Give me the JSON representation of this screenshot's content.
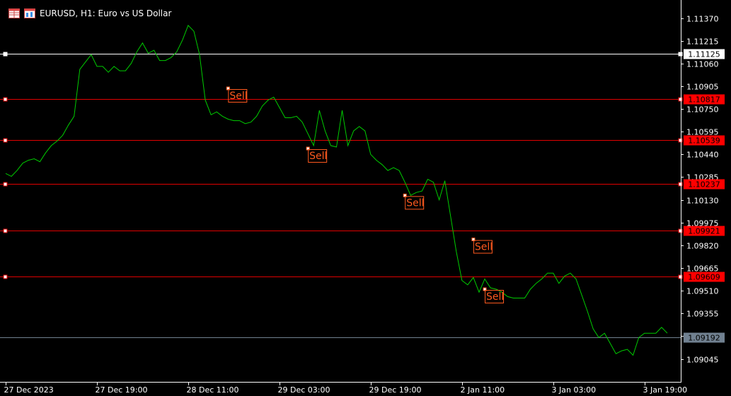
{
  "header": {
    "title": "EURUSD, H1:  Euro vs US Dollar",
    "icons": [
      "table-icon",
      "chart-icon"
    ]
  },
  "colors": {
    "background": "#000000",
    "price_line": "#00cc00",
    "sell_level": "#e00000",
    "current_level": "#ffffff",
    "bid_level": "#708090",
    "sell_label": "#ff5a1f",
    "text": "#ffffff"
  },
  "chart_data": {
    "type": "line",
    "symbol": "EURUSD",
    "timeframe": "H1",
    "title": "EURUSD, H1:  Euro vs US Dollar",
    "ylim": [
      1.0898,
      1.1145
    ],
    "y_ticks": [
      "1.11370",
      "1.11215",
      "1.11060",
      "1.10905",
      "1.10750",
      "1.10595",
      "1.10440",
      "1.10285",
      "1.10130",
      "1.09975",
      "1.09820",
      "1.09665",
      "1.09510",
      "1.09355",
      "1.09200",
      "1.09045"
    ],
    "x_ticks": [
      "27 Dec 2023",
      "27 Dec 19:00",
      "28 Dec 11:00",
      "29 Dec 03:00",
      "29 Dec 19:00",
      "2 Jan 11:00",
      "3 Jan 03:00",
      "3 Jan 19:00"
    ],
    "x_tick_bars": [
      0,
      16,
      32,
      48,
      64,
      80,
      96,
      112
    ],
    "series": [
      {
        "values": [
          1.1031,
          1.1029,
          1.1033,
          1.1038,
          1.104,
          1.1041,
          1.1039,
          1.1045,
          1.105,
          1.1053,
          1.1057,
          1.1064,
          1.107,
          1.1102,
          1.1107,
          1.1112,
          1.1104,
          1.1104,
          1.11,
          1.1104,
          1.1101,
          1.1101,
          1.1106,
          1.1114,
          1.112,
          1.1113,
          1.1115,
          1.1108,
          1.1108,
          1.111,
          1.1114,
          1.1122,
          1.1132,
          1.1128,
          1.1112,
          1.1081,
          1.1071,
          1.1073,
          1.107,
          1.1068,
          1.1067,
          1.1067,
          1.1065,
          1.1066,
          1.107,
          1.1077,
          1.1081,
          1.1083,
          1.1076,
          1.1069,
          1.1069,
          1.107,
          1.1066,
          1.1058,
          1.105,
          1.1074,
          1.106,
          1.105,
          1.1049,
          1.1074,
          1.105,
          1.106,
          1.1063,
          1.106,
          1.1044,
          1.104,
          1.1037,
          1.1033,
          1.1035,
          1.1033,
          1.1025,
          1.1016,
          1.1018,
          1.1019,
          1.1027,
          1.1025,
          1.1013,
          1.1026,
          1.1002,
          1.0978,
          1.0958,
          1.0955,
          1.096,
          1.095,
          1.0959,
          1.0953,
          1.0952,
          1.095,
          1.0947,
          1.0946,
          1.0946,
          1.0946,
          1.0952,
          1.0956,
          1.0959,
          1.0963,
          1.0963,
          1.0956,
          1.0961,
          1.0963,
          1.0959,
          1.0948,
          1.0937,
          1.0925,
          1.0919,
          1.0922,
          1.0915,
          1.0908,
          1.091,
          1.0911,
          1.0907,
          1.0919,
          1.0922,
          1.0922,
          1.0922,
          1.0926,
          1.0922
        ]
      }
    ],
    "horizontal_lines": [
      {
        "price": 1.11125,
        "label": "1.11125",
        "kind": "current"
      },
      {
        "price": 1.10817,
        "label": "1.10817",
        "kind": "sell"
      },
      {
        "price": 1.10539,
        "label": "1.10539",
        "kind": "sell"
      },
      {
        "price": 1.10237,
        "label": "1.10237",
        "kind": "sell"
      },
      {
        "price": 1.09921,
        "label": "1.09921",
        "kind": "sell"
      },
      {
        "price": 1.09609,
        "label": "1.09609",
        "kind": "sell"
      },
      {
        "price": 1.09192,
        "label": "1.09192",
        "kind": "bid"
      }
    ],
    "annotations": [
      {
        "text": "Sell",
        "bar": 39,
        "price": 1.1089
      },
      {
        "text": "Sell",
        "bar": 53,
        "price": 1.1048
      },
      {
        "text": "Sell",
        "bar": 70,
        "price": 1.1016
      },
      {
        "text": "Sell",
        "bar": 82,
        "price": 1.0986
      },
      {
        "text": "Sell",
        "bar": 84,
        "price": 1.0952
      }
    ],
    "grid": false
  }
}
